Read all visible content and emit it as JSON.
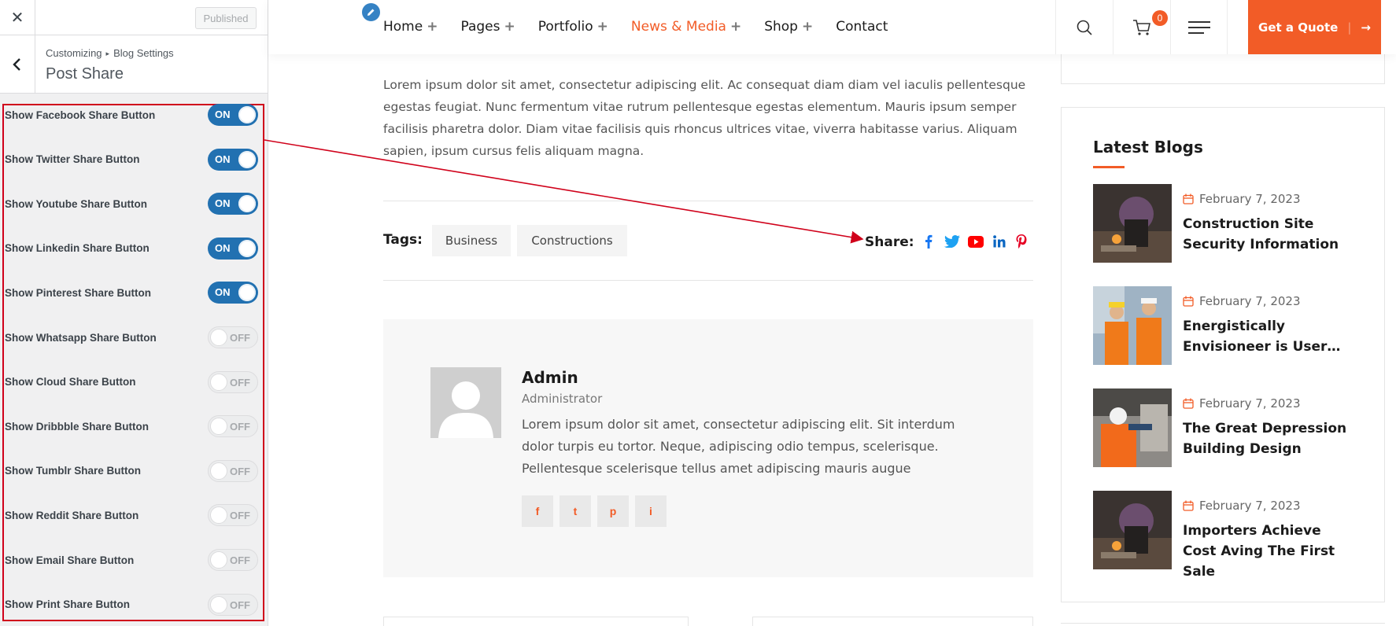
{
  "customizer": {
    "close_glyph": "✕",
    "publish_label": "Published",
    "breadcrumb_root": "Customizing",
    "breadcrumb_section": "Blog Settings",
    "section_title": "Post Share",
    "controls": [
      {
        "label": "Show Facebook Share Button",
        "state": "ON"
      },
      {
        "label": "Show Twitter Share Button",
        "state": "ON"
      },
      {
        "label": "Show Youtube Share Button",
        "state": "ON"
      },
      {
        "label": "Show Linkedin Share Button",
        "state": "ON"
      },
      {
        "label": "Show Pinterest Share Button",
        "state": "ON"
      },
      {
        "label": "Show Whatsapp Share Button",
        "state": "OFF"
      },
      {
        "label": "Show Cloud Share Button",
        "state": "OFF"
      },
      {
        "label": "Show Dribbble Share Button",
        "state": "OFF"
      },
      {
        "label": "Show Tumblr Share Button",
        "state": "OFF"
      },
      {
        "label": "Show Reddit Share Button",
        "state": "OFF"
      },
      {
        "label": "Show Email Share Button",
        "state": "OFF"
      },
      {
        "label": "Show Print Share Button",
        "state": "OFF"
      }
    ]
  },
  "nav": {
    "items": [
      {
        "label": "Home",
        "has_sub": true
      },
      {
        "label": "Pages",
        "has_sub": true
      },
      {
        "label": "Portfolio",
        "has_sub": true
      },
      {
        "label": "News & Media",
        "has_sub": true,
        "active": true
      },
      {
        "label": "Shop",
        "has_sub": true
      },
      {
        "label": "Contact",
        "has_sub": false
      }
    ],
    "plus": "+",
    "cart_count": "0",
    "quote_label": "Get a Quote",
    "quote_sep": "|",
    "quote_arrow": "→"
  },
  "article": {
    "body": "Lorem ipsum dolor sit amet, consectetur adipiscing elit. Ac consequat diam diam vel iaculis pellentesque egestas feugiat. Nunc fermentum vitae rutrum pellentesque egestas elementum. Mauris ipsum semper facilisis pharetra dolor. Diam vitae facilisis quis rhoncus ultrices vitae, viverra habitasse varius. Aliquam sapien, ipsum cursus felis aliquam magna.",
    "tags_label": "Tags:",
    "tags": [
      "Business",
      "Constructions"
    ],
    "share_label": "Share:",
    "share_icons": [
      "facebook-icon",
      "twitter-icon",
      "youtube-icon",
      "linkedin-icon",
      "pinterest-icon"
    ]
  },
  "author": {
    "name": "Admin",
    "role": "Administrator",
    "bio": "Lorem ipsum dolor sit amet, consectetur adipiscing elit. Sit interdum dolor turpis eu tortor. Neque, adipiscing odio tempus, scelerisque. Pellentesque scelerisque tellus amet adipiscing mauris augue",
    "socials": [
      "f",
      "t",
      "p",
      "i"
    ]
  },
  "latest_blogs": {
    "title": "Latest Blogs",
    "posts": [
      {
        "date": "February 7, 2023",
        "title": "Construction Site Security Information"
      },
      {
        "date": "February 7, 2023",
        "title": "Energistically Envisioneer is User…"
      },
      {
        "date": "February 7, 2023",
        "title": "The Great Depression Building Design"
      },
      {
        "date": "February 7, 2023",
        "title": "Importers Achieve Cost Aving The First Sale"
      }
    ]
  },
  "colors": {
    "accent": "#f25c27",
    "wp_blue": "#2271b1",
    "annotation_red": "#d0021b",
    "facebook": "#1877f2",
    "twitter": "#1da1f2",
    "youtube": "#ff0000",
    "linkedin": "#0a66c2",
    "pinterest": "#e60023"
  }
}
